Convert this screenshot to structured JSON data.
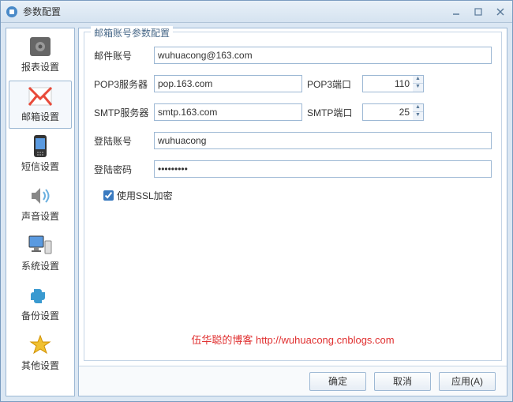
{
  "window": {
    "title": "参数配置"
  },
  "sidebar": {
    "items": [
      {
        "label": "报表设置"
      },
      {
        "label": "邮箱设置"
      },
      {
        "label": "短信设置"
      },
      {
        "label": "声音设置"
      },
      {
        "label": "系统设置"
      },
      {
        "label": "备份设置"
      },
      {
        "label": "其他设置"
      }
    ]
  },
  "group": {
    "title": "邮箱账号参数配置"
  },
  "form": {
    "mail_account_label": "邮件账号",
    "mail_account_value": "wuhuacong@163.com",
    "pop3_server_label": "POP3服务器",
    "pop3_server_value": "pop.163.com",
    "pop3_port_label": "POP3端口",
    "pop3_port_value": "110",
    "smtp_server_label": "SMTP服务器",
    "smtp_server_value": "smtp.163.com",
    "smtp_port_label": "SMTP端口",
    "smtp_port_value": "25",
    "login_account_label": "登陆账号",
    "login_account_value": "wuhuacong",
    "login_password_label": "登陆密码",
    "login_password_value": "•••••••••",
    "ssl_label": "使用SSL加密"
  },
  "watermark": "伍华聪的博客 http://wuhuacong.cnblogs.com",
  "footer": {
    "ok": "确定",
    "cancel": "取消",
    "apply": "应用(A)"
  }
}
